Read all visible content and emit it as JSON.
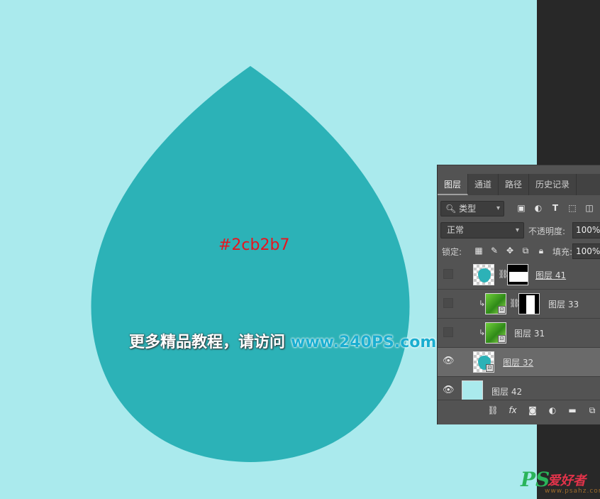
{
  "canvas": {
    "background_color": "#aaeaed",
    "shape_color": "#2cb2b7",
    "color_label": "#2cb2b7",
    "color_label_color": "#e8141e"
  },
  "promo": {
    "chinese_text": "更多精品教程，请访问",
    "url_text": "www.240PS.com"
  },
  "layers_panel": {
    "tabs": [
      "图层",
      "通道",
      "路径",
      "历史记录"
    ],
    "active_tab": "图层",
    "filter": {
      "label": "类型",
      "icon": "search-icon"
    },
    "filter_icons": [
      "image-filter-icon",
      "adjustment-filter-icon",
      "text-filter-icon",
      "shape-filter-icon",
      "smart-object-filter-icon"
    ],
    "blend_mode": "正常",
    "opacity_label": "不透明度:",
    "opacity_value": "100%",
    "lock_label": "锁定:",
    "lock_icons": [
      "lock-transparent-icon",
      "lock-paint-icon",
      "lock-move-icon",
      "lock-artboard-icon",
      "lock-all-icon"
    ],
    "fill_label": "填充:",
    "fill_value": "100%",
    "layers": [
      {
        "name": "图层 41",
        "visible": false,
        "selected": false
      },
      {
        "name": "图层 33",
        "visible": false,
        "selected": false
      },
      {
        "name": "图层 31",
        "visible": false,
        "selected": false
      },
      {
        "name": "图层 32",
        "visible": true,
        "selected": true
      },
      {
        "name": "图层 42",
        "visible": true,
        "selected": false
      }
    ],
    "bottom_icons": [
      "link-layers-icon",
      "fx-icon",
      "add-mask-icon",
      "adjustment-layer-icon",
      "new-group-icon",
      "new-layer-icon"
    ]
  },
  "watermark": {
    "logo": "PS",
    "chinese": "爱好者",
    "url": "www.psahz.com"
  }
}
